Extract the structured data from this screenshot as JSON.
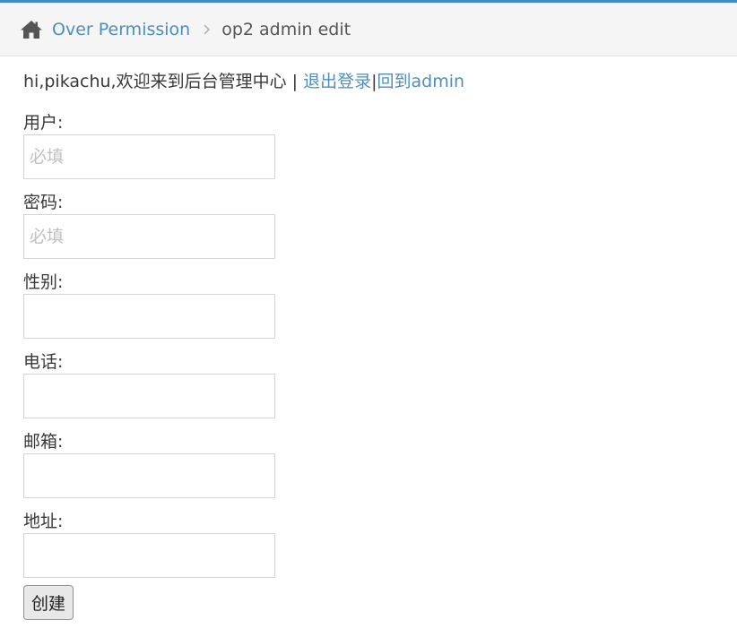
{
  "breadcrumb": {
    "home_icon": "home-icon",
    "link_label": "Over Permission",
    "separator_icon": "chevron-right-icon",
    "current_label": "op2 admin edit"
  },
  "greeting": {
    "text": "hi,pikachu,欢迎来到后台管理中心 | ",
    "logout_label": "退出登录",
    "divider": "|",
    "back_label": "回到admin"
  },
  "form": {
    "fields": [
      {
        "label": "用户:",
        "placeholder": "必填",
        "value": ""
      },
      {
        "label": "密码:",
        "placeholder": "必填",
        "value": ""
      },
      {
        "label": "性别:",
        "placeholder": "",
        "value": ""
      },
      {
        "label": "电话:",
        "placeholder": "",
        "value": ""
      },
      {
        "label": "邮箱:",
        "placeholder": "",
        "value": ""
      },
      {
        "label": "地址:",
        "placeholder": "",
        "value": ""
      }
    ],
    "submit_label": "创建"
  },
  "colors": {
    "accent": "#428bca",
    "link": "#4c8fbd"
  }
}
